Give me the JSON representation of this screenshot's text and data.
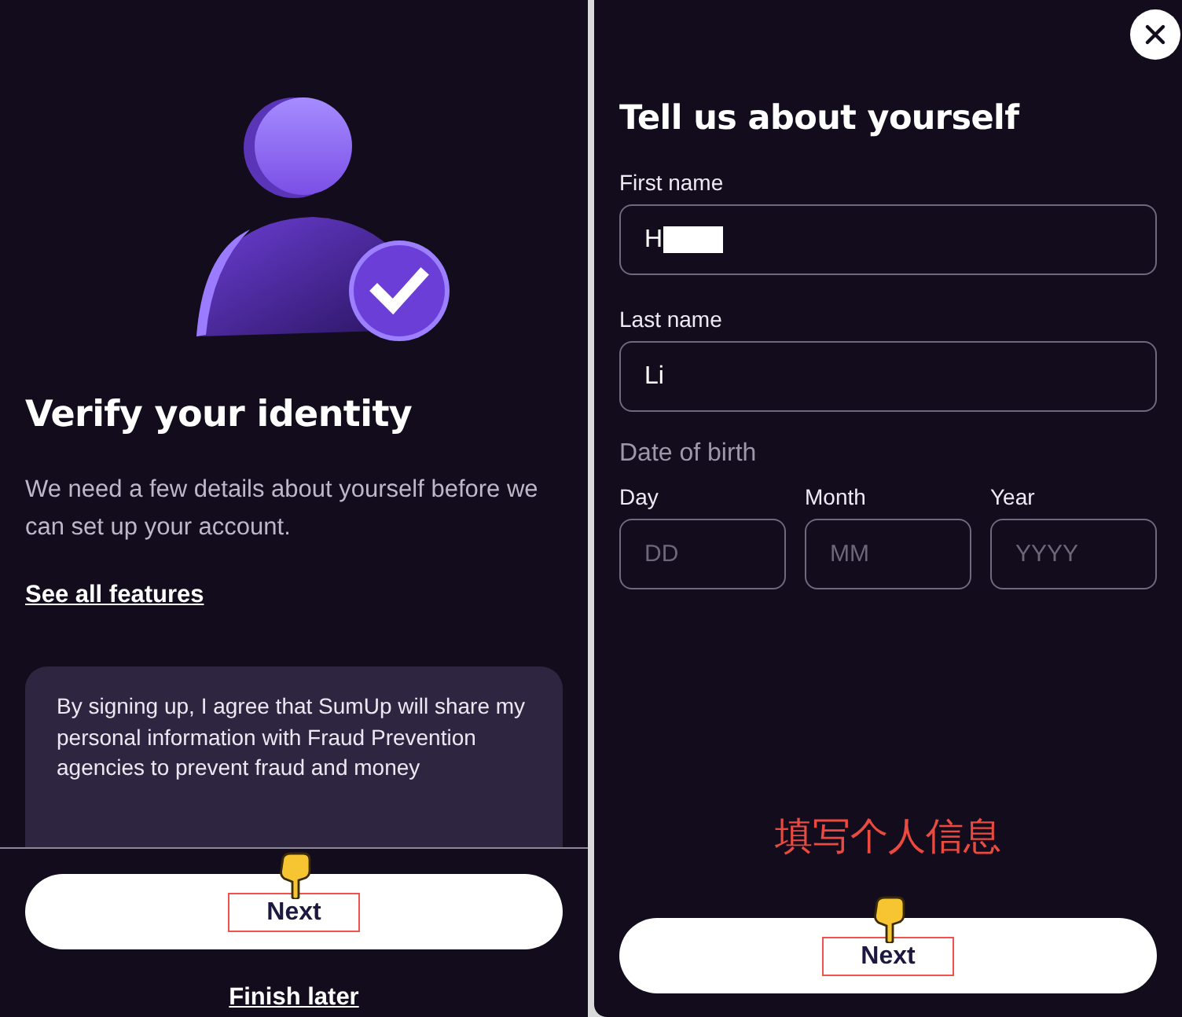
{
  "left": {
    "title": "Verify your identity",
    "description": "We need a few details about yourself before we can set up your account.",
    "features_link": "See all features",
    "consent_text": "By signing up, I agree that SumUp will share my personal information with Fraud Prevention agencies to prevent fraud and money",
    "next_button": {
      "label": "Next",
      "highlighted": true
    },
    "finish_later": "Finish later"
  },
  "right": {
    "title": "Tell us about yourself",
    "fields": [
      {
        "label": "First name",
        "value": "H",
        "redacted": true
      },
      {
        "label": "Last name",
        "value": "Li",
        "redacted": false
      }
    ],
    "date_of_birth": {
      "label": "Date of birth",
      "parts": [
        {
          "label": "Day",
          "placeholder": "DD"
        },
        {
          "label": "Month",
          "placeholder": "MM"
        },
        {
          "label": "Year",
          "placeholder": "YYYY"
        }
      ]
    },
    "caption": "填写个人信息",
    "next_button": {
      "label": "Next",
      "highlighted": true
    }
  }
}
